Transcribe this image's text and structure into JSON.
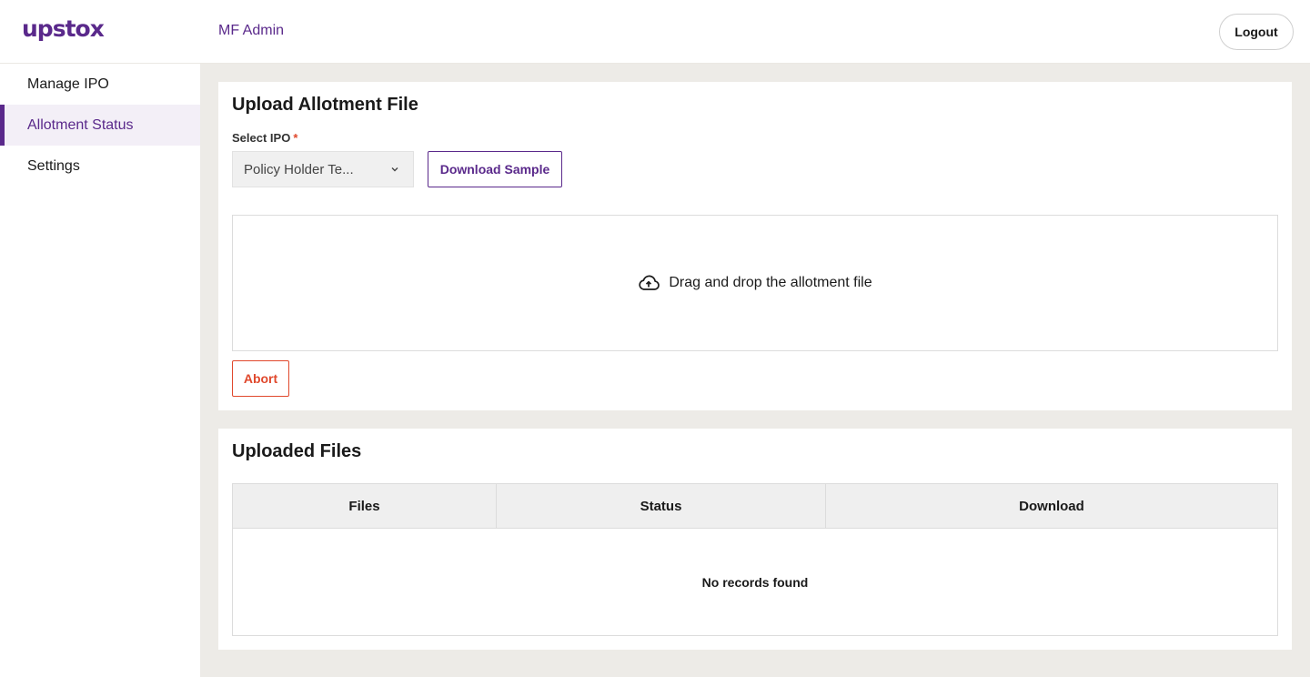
{
  "header": {
    "logo_text": "upstox",
    "app_title": "MF Admin",
    "logout_label": "Logout"
  },
  "sidebar": {
    "items": [
      {
        "label": "Manage IPO",
        "active": false
      },
      {
        "label": "Allotment Status",
        "active": true
      },
      {
        "label": "Settings",
        "active": false
      }
    ]
  },
  "upload_card": {
    "title": "Upload Allotment File",
    "select_label": "Select IPO",
    "required_marker": "*",
    "select_value": "Policy Holder Te...",
    "download_sample_label": "Download Sample",
    "dropzone_text": "Drag and drop the allotment file",
    "dropzone_icon": "cloud-upload-icon",
    "abort_label": "Abort"
  },
  "files_card": {
    "title": "Uploaded Files",
    "columns": [
      "Files",
      "Status",
      "Download"
    ],
    "empty_text": "No records found"
  },
  "colors": {
    "brand": "#5a298b",
    "danger": "#e0482c",
    "background": "#edebe7"
  }
}
